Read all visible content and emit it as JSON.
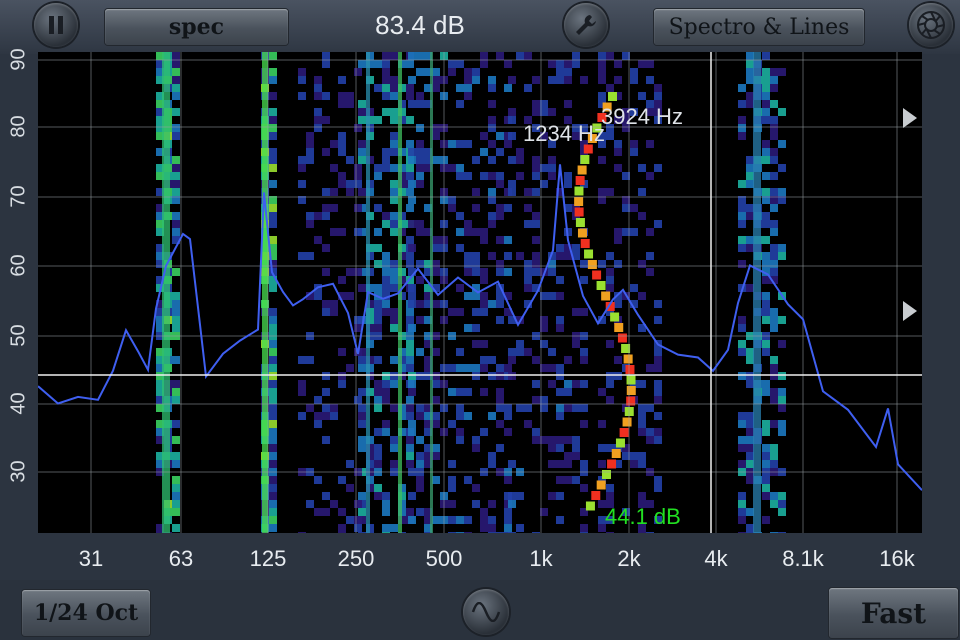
{
  "toolbar": {
    "mode_label": "spec",
    "level_readout": "83.4 dB",
    "view_label": "Spectro & Lines"
  },
  "plot": {
    "y_ticks": [
      "90",
      "80",
      "70",
      "60",
      "50",
      "40",
      "30"
    ],
    "x_ticks": [
      "31",
      "63",
      "125",
      "250",
      "500",
      "1k",
      "2k",
      "4k",
      "8.1k",
      "16k"
    ],
    "peak_labels": [
      "1234 Hz",
      "3924 Hz"
    ],
    "cursor_db": "44.1 dB"
  },
  "bottom": {
    "date_label": "1/24 Oct",
    "speed_label": "Fast"
  },
  "colors": {
    "spectrum_line": "#3f5ff0",
    "cursor_db": "#22e022",
    "grid": "#9aa0a6"
  }
}
